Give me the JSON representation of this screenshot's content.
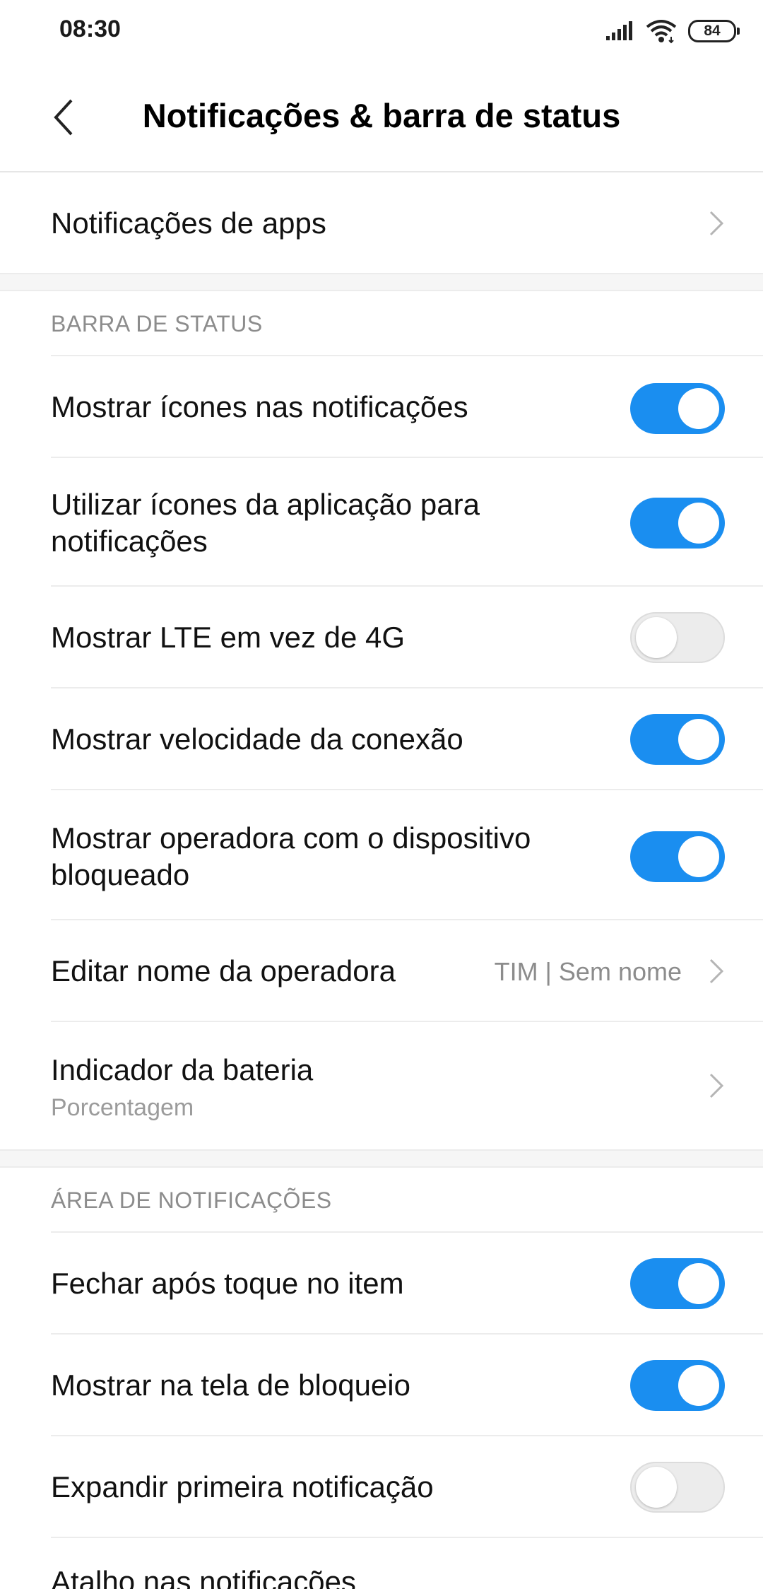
{
  "status_bar": {
    "time": "08:30",
    "battery": "84"
  },
  "header": {
    "title": "Notificações & barra de status"
  },
  "app_notifications": {
    "label": "Notificações de apps"
  },
  "status_bar_section": {
    "title": "BARRA DE STATUS",
    "items": [
      {
        "line1": "Mostrar ícones nas notificações",
        "toggle": true
      },
      {
        "line1": "Utilizar ícones da aplicação para",
        "line2": "notificações",
        "toggle": true
      },
      {
        "line1": "Mostrar LTE em vez de 4G",
        "toggle": false
      },
      {
        "line1": "Mostrar velocidade da conexão",
        "toggle": true
      },
      {
        "line1": "Mostrar operadora com o dispositivo",
        "line2": "bloqueado",
        "toggle": true
      }
    ],
    "carrier_name": {
      "label": "Editar nome da operadora",
      "value": "TIM | Sem nome"
    },
    "battery_indicator": {
      "label": "Indicador da bateria",
      "value": "Porcentagem"
    }
  },
  "notification_area": {
    "title": "ÁREA DE NOTIFICAÇÕES",
    "items": [
      {
        "label": "Fechar após toque no item",
        "toggle": true
      },
      {
        "label": "Mostrar na tela de bloqueio",
        "toggle": true
      },
      {
        "label": "Expandir primeira notificação",
        "toggle": false
      },
      {
        "label": "Atalho nas notificações"
      }
    ]
  },
  "colors": {
    "accent": "#1a8ef0",
    "toggle_off": "#ececec"
  }
}
